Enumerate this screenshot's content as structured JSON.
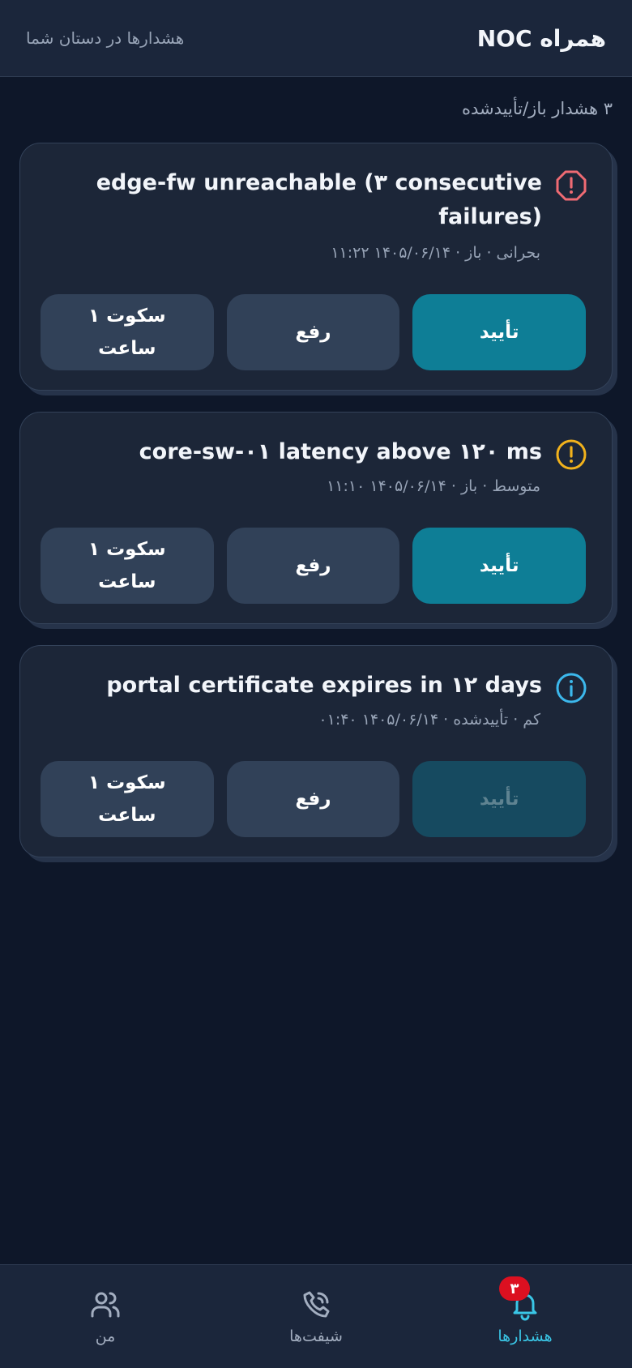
{
  "header": {
    "title": "همراه NOC",
    "subtitle": "هشدارها در دستان شما"
  },
  "summary": "۳ هشدار باز/تأییدشده",
  "alerts": [
    {
      "severity": "critical",
      "icon": "critical-octagon-icon",
      "color": "#ef6b73",
      "title": "edge-fw unreachable (۳ consecutive failures)",
      "meta": "بحرانی · باز · ۱۴۰۵/۰۶/۱۴ ۱۱:۲۲",
      "actions": {
        "ack": "تأیید",
        "resolve": "رفع",
        "mute": "سکوت ۱ ساعت"
      },
      "ack_enabled": true
    },
    {
      "severity": "medium",
      "icon": "warning-circle-icon",
      "color": "#f2b21c",
      "title": "core-sw-۰۱ latency above ۱۲۰ ms",
      "meta": "متوسط · باز · ۱۴۰۵/۰۶/۱۴ ۱۱:۱۰",
      "actions": {
        "ack": "تأیید",
        "resolve": "رفع",
        "mute": "سکوت ۱ ساعت"
      },
      "ack_enabled": true
    },
    {
      "severity": "low",
      "icon": "info-circle-icon",
      "color": "#3cb8ec",
      "title": "portal certificate expires in ۱۲ days",
      "meta": "کم · تأییدشده · ۱۴۰۵/۰۶/۱۴ ۰۱:۴۰",
      "actions": {
        "ack": "تأیید",
        "resolve": "رفع",
        "mute": "سکوت ۱ ساعت"
      },
      "ack_enabled": false
    }
  ],
  "nav": {
    "alerts": {
      "label": "هشدارها",
      "badge": "۳",
      "icon": "bell-icon"
    },
    "shifts": {
      "label": "شیفت‌ها",
      "icon": "phone-icon"
    },
    "me": {
      "label": "من",
      "icon": "users-icon"
    }
  },
  "colors": {
    "accent": "#3ac6e6",
    "primary_button": "#0e7e96",
    "badge": "#dc1020"
  }
}
